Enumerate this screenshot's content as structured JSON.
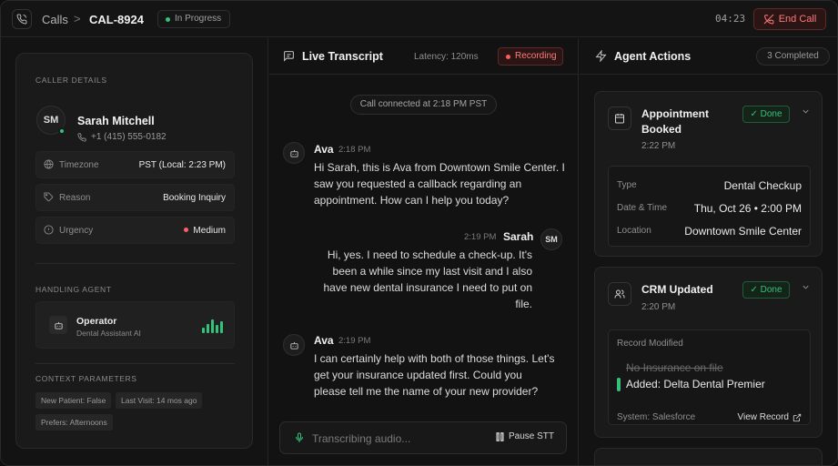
{
  "header": {
    "breadcrumb_root": "Calls",
    "breadcrumb_sep": ">",
    "call_id": "CAL-8924",
    "status": "In Progress",
    "timer": "04:23",
    "end_call_label": "End Call"
  },
  "caller": {
    "section_label": "CALLER DETAILS",
    "initials": "SM",
    "name": "Sarah Mitchell",
    "phone": "+1 (415) 555-0182",
    "rows": [
      {
        "label": "Timezone",
        "value": "PST (Local: 2:23 PM)"
      },
      {
        "label": "Reason",
        "value": "Booking Inquiry"
      },
      {
        "label": "Urgency",
        "value": "Medium"
      }
    ]
  },
  "handling_agent": {
    "section_label": "HANDLING AGENT",
    "name": "Operator",
    "subtitle": "Dental Assistant AI"
  },
  "context": {
    "section_label": "CONTEXT PARAMETERS",
    "chips": [
      "New Patient: False",
      "Last Visit: 14 mos ago",
      "Prefers: Afternoons"
    ]
  },
  "transcript": {
    "title": "Live Transcript",
    "latency": "Latency: 120ms",
    "recording_label": "Recording",
    "system_message": "Call connected at 2:18 PM PST",
    "messages": [
      {
        "speaker": "Ava",
        "time": "2:18 PM",
        "lines": [
          "Hi Sarah, this is Ava from Downtown Smile Center. I",
          "saw you requested a callback regarding an",
          "appointment. How can I help you today?"
        ]
      },
      {
        "speaker": "Sarah",
        "time": "2:19 PM",
        "initials": "SM",
        "lines": [
          "Hi, yes. I need to schedule a check-up. It's",
          "been a while since my last visit and I also",
          "have new dental insurance I need to put on",
          "file."
        ]
      },
      {
        "speaker": "Ava",
        "time": "2:19 PM",
        "lines": [
          "I can certainly help with both of those things. Let's",
          "get your insurance updated first. Could you",
          "please tell me the name of your new provider?"
        ]
      }
    ],
    "input_placeholder": "Transcribing audio...",
    "pause_label": "Pause STT"
  },
  "actions": {
    "title": "Agent Actions",
    "completed": "3 Completed",
    "done_label": "Done",
    "appointment": {
      "title_line1": "Appointment",
      "title_line2": "Booked",
      "time": "2:22 PM",
      "details": [
        {
          "key": "Type",
          "value": "Dental Checkup"
        },
        {
          "key": "Date & Time",
          "value": "Thu, Oct 26 • 2:00 PM"
        },
        {
          "key": "Location",
          "value": "Downtown Smile Center"
        }
      ]
    },
    "crm": {
      "title": "CRM Updated",
      "time": "2:20 PM",
      "modified_label": "Record Modified",
      "removed": "No Insurance on file",
      "added": "Added: Delta Dental Premier",
      "system": "System: Salesforce",
      "view_record": "View Record"
    }
  },
  "colors": {
    "accent_green": "#34c27a",
    "danger_red": "#ff7b7b",
    "background": "#121212"
  }
}
